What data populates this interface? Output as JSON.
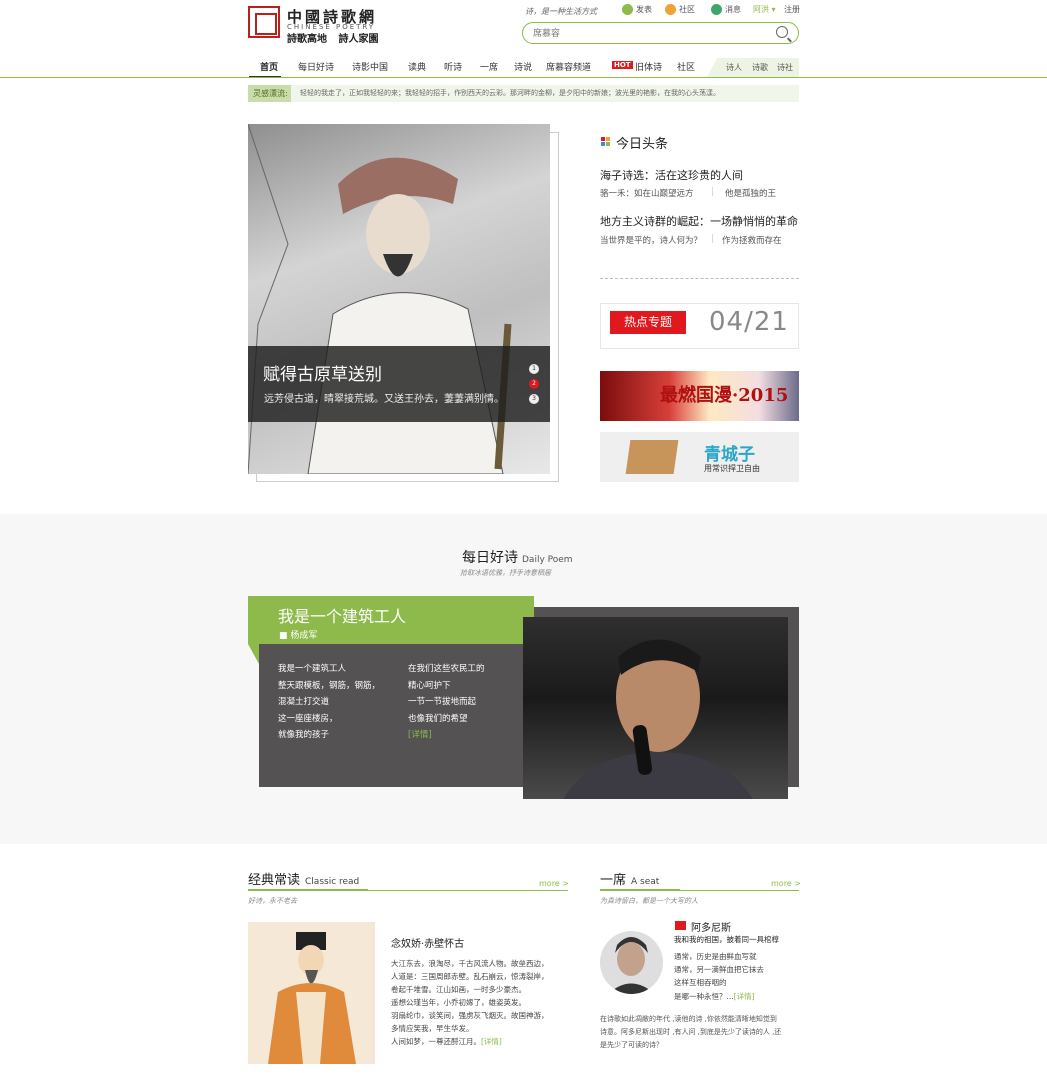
{
  "logo": {
    "cn": "中國詩歌網",
    "en": "CHINESE POETRY",
    "sub": "詩歌高地 詩人家園"
  },
  "top": {
    "slogan": "诗，是一种生活方式",
    "post": "发表",
    "community": "社区",
    "message": "消息",
    "user": "阿洪 ▾",
    "logout": "注册"
  },
  "search": {
    "placeholder": "席慕容"
  },
  "nav": {
    "items": [
      "首页",
      "每日好诗",
      "诗影中国",
      "读典",
      "听诗",
      "一席",
      "诗说",
      "席慕容频道",
      "旧体诗",
      "社区"
    ],
    "hot": "HOT",
    "right": [
      "诗人",
      "诗歌",
      "诗社"
    ]
  },
  "ticker": {
    "tag": "灵感漂流:",
    "text": "轻轻的我走了，正如我轻轻的来；我轻轻的招手，作别西天的云彩。那河畔的金柳，是夕阳中的新娘；波光里的艳影，在我的心头荡漾。"
  },
  "hero": {
    "title": "赋得古原草送别",
    "text": "远芳侵古道，晴翠接荒城。又送王孙去，萋萋满别情。",
    "pages": [
      "1",
      "2",
      "3"
    ]
  },
  "headlines": {
    "title": "今日头条",
    "items": [
      {
        "title": "海子诗选：活在这珍贵的人间",
        "subs": [
          "骆一禾：如在山巅望远方",
          "他是孤独的王"
        ]
      },
      {
        "title": "地方主义诗群的崛起：一场静悄悄的革命",
        "subs": [
          "当世界是平的，诗人何为？",
          "作为拯救而存在"
        ]
      }
    ],
    "hot_btn": "热点专题",
    "hot_date": "04/21"
  },
  "ads": {
    "ad1_text": "最燃国漫·2015",
    "ad2_text": "青城子",
    "ad2_sub": "用常识捍卫自由"
  },
  "daily": {
    "title": "每日好诗",
    "title_en": "Daily Poem",
    "sub": "拾取冰语优雅，抒手诗意栖居",
    "poem_title": "我是一个建筑工人",
    "author": "杨成军",
    "col1": [
      "我是一个建筑工人",
      "整天跟模板，钢筋，钢筋，",
      "混凝土打交道",
      "这一座座楼房，",
      "就像我的孩子"
    ],
    "col2": [
      "在我们这些农民工的",
      "精心呵护下",
      "一节一节拔地而起",
      "也像我们的希望"
    ],
    "more": "[详情]"
  },
  "classic": {
    "title": "经典常读",
    "title_en": "Classic read",
    "more": "more >",
    "sub": "好诗，永不老去",
    "poem_title": "念奴娇·赤壁怀古",
    "lines": [
      "大江东去，浪淘尽，千古风流人物。故垒西边，",
      "人道是：三国周郎赤壁。乱石崩云，惊涛裂岸，",
      "卷起千堆雪。江山如画，一时多少豪杰。",
      "遥想公瑾当年，小乔初嫁了，雄姿英发。",
      "羽扇纶巾，谈笑间，强虏灰飞烟灭。故国神游，",
      "多情应笑我，早生华发。",
      "人间如梦，一尊还酹江月。"
    ],
    "more_detail": "[详情]"
  },
  "seat": {
    "title": "一席",
    "title_en": "A seat",
    "more": "more >",
    "sub": "为真诗留白，都是一个大写的人",
    "poet": "阿多尼斯",
    "head": "我和我的祖国，披着同一具棺椁",
    "lines": [
      "通常，历史是由鲜血写就",
      "通常，另一滴鲜血把它抹去",
      "这样互相吞咽的",
      "是哪一种永恒？..."
    ],
    "more_detail": "[详情]",
    "desc": [
      "在诗歌如此凋敝的年代 ,读他的诗 ,你依然能清晰地知觉到",
      "诗意。阿多尼斯出现时 ,有人问 ,到底是先少了读诗的人 ,还",
      "是先少了可读的诗？"
    ]
  },
  "colors": {
    "accent": "#8dba4a",
    "hot": "#e0191e",
    "dark": "#545253"
  }
}
